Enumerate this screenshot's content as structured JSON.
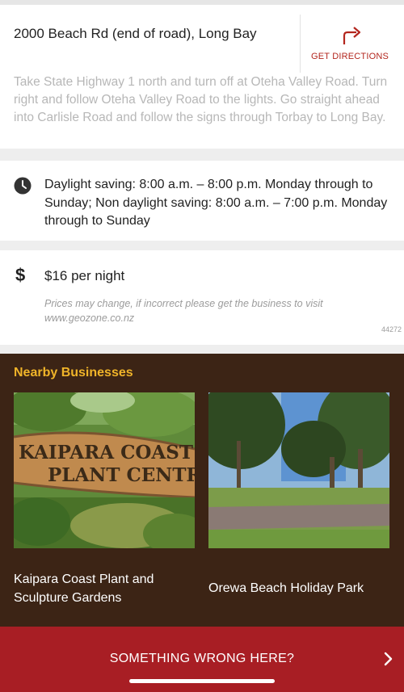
{
  "location": {
    "address": "2000 Beach Rd (end of road), Long Bay",
    "get_directions_label": "GET DIRECTIONS",
    "directions_text": "Take State Highway 1 north and turn off at Oteha Valley Road. Turn right and follow Oteha Valley Road to the lights. Go straight ahead into Carlisle Road and follow the signs through Torbay to Long Bay."
  },
  "hours": {
    "icon": "clock-icon",
    "text": "Daylight saving: 8:00 a.m. – 8:00 p.m. Monday through to Sunday; Non daylight saving: 8:00 a.m. – 7:00 p.m. Monday through to Sunday"
  },
  "price": {
    "icon": "dollar-icon",
    "symbol": "$",
    "text": "$16 per night",
    "note": "Prices may change, if incorrect please get the business to visit www.geozone.co.nz",
    "listing_id": "44272"
  },
  "nearby": {
    "title": "Nearby Businesses",
    "businesses": [
      {
        "name": "Kaipara Coast Plant and Sculpture Gardens",
        "sign_text_line1": "KAIPARA COAST",
        "sign_text_line2": "PLANT CENTRE"
      },
      {
        "name": "Orewa Beach Holiday Park"
      }
    ]
  },
  "report": {
    "label": "SOMETHING WRONG HERE?"
  },
  "colors": {
    "accent_red": "#a81e24",
    "nearby_bg": "#3c2415",
    "nearby_title": "#f0b429",
    "muted_text": "#b7b7b7"
  }
}
